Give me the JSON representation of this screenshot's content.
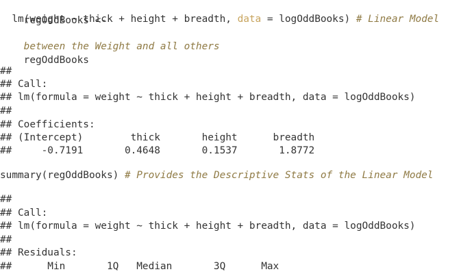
{
  "code1": {
    "line1": "regOddBooks <-",
    "line2_pre": "  lm(weight ~ thick + height + breadth, ",
    "line2_arg": "data",
    "line2_post": " = logOddBooks) ",
    "line2_comment": "# Linear Model",
    "line3_comment": "between the Weight and all others",
    "line4": "regOddBooks"
  },
  "output1": {
    "blank": "##",
    "call_header": "## Call:",
    "call": "## lm(formula = weight ~ thick + height + breadth, data = logOddBooks)",
    "blank2": "##",
    "coef_header": "## Coefficients:",
    "coef_names": "## (Intercept)        thick       height      breadth",
    "coef_values": "##     -0.7191       0.4648       0.1537       1.8772"
  },
  "code2": {
    "call": "summary(regOddBooks) ",
    "comment": "# Provides the Descriptive Stats of the Linear Model"
  },
  "output2": {
    "blank": "##",
    "call_header": "## Call:",
    "call": "## lm(formula = weight ~ thick + height + breadth, data = logOddBooks)",
    "blank2": "##",
    "residuals_header": "## Residuals:",
    "residuals_cols": "##      Min       1Q   Median       3Q      Max"
  }
}
